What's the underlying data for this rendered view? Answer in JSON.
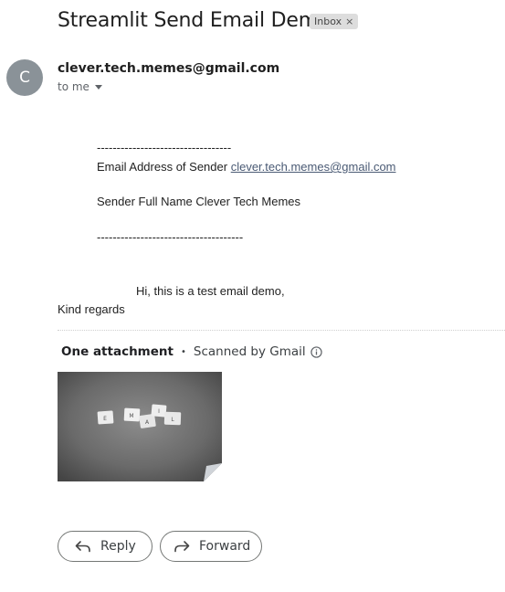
{
  "email": {
    "subject": "Streamlit Send Email Demo",
    "label": "Inbox",
    "label_close": "×",
    "avatar_letter": "C",
    "sender": "clever.tech.memes@gmail.com",
    "recipient": "to me"
  },
  "body": {
    "separator_top": "----------------------------------",
    "sender_email_label": "Email Address of Sender",
    "sender_email_value": "clever.tech.memes@gmail.com",
    "sender_name_line": "Sender Full Name Clever Tech Memes",
    "separator_bottom": "-------------------------------------",
    "message": "Hi, this is a test email demo,",
    "closing": "Kind regards"
  },
  "attachments": {
    "title": "One attachment",
    "separator": "•",
    "scan_status": "Scanned by Gmail",
    "thumbnail_tiles": [
      "E",
      "M",
      "A",
      "I",
      "L"
    ]
  },
  "actions": {
    "reply": "Reply",
    "forward": "Forward"
  }
}
